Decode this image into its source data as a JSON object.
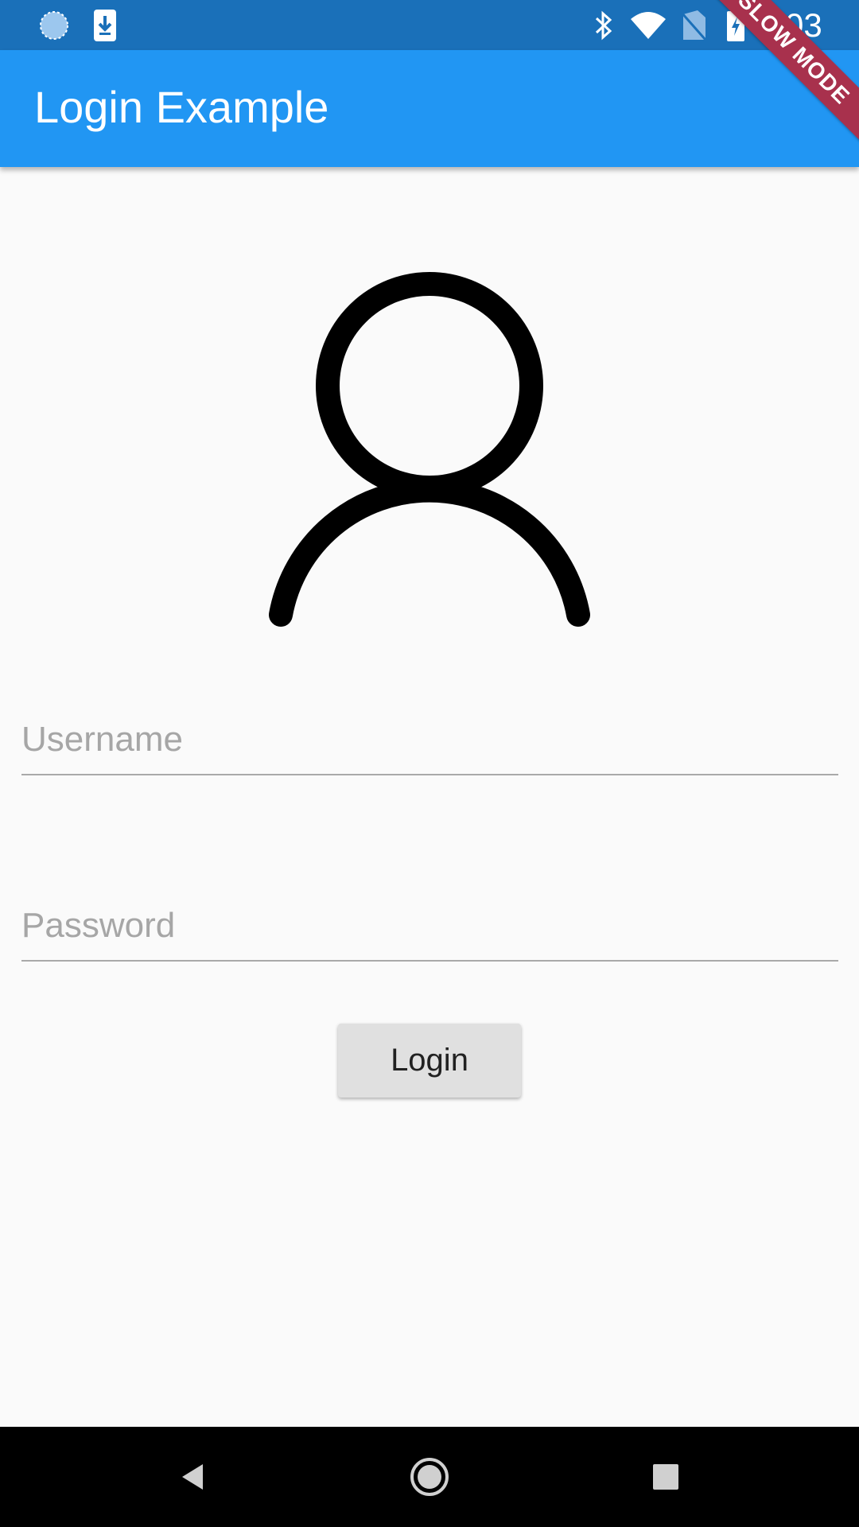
{
  "status_bar": {
    "time": "3:03",
    "icons": [
      "sync-icon",
      "download-icon",
      "bluetooth-icon",
      "wifi-icon",
      "no-sim-icon",
      "battery-charging-icon"
    ]
  },
  "app_bar": {
    "title": "Login Example",
    "color": "#2196f3"
  },
  "debug_banner": {
    "label": "SLOW MODE"
  },
  "avatar": {
    "icon": "person-outline-icon"
  },
  "form": {
    "username_placeholder": "Username",
    "username_value": "",
    "password_placeholder": "Password",
    "password_value": "",
    "login_label": "Login"
  },
  "nav_bar": {
    "buttons": [
      "back-icon",
      "home-icon",
      "recents-icon"
    ]
  }
}
